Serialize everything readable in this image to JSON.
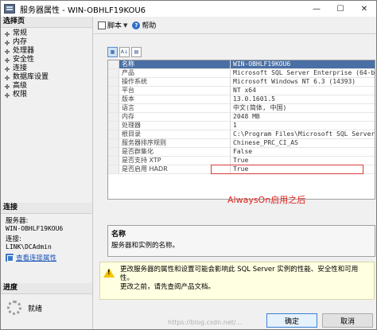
{
  "window": {
    "title": "服务器属性 - WIN-OBHLF19KOU6",
    "minimize_label": "—",
    "maximize_label": "☐",
    "close_label": "✕"
  },
  "sidebar": {
    "select_page_header": "选择页",
    "items": [
      {
        "label": "常规"
      },
      {
        "label": "内存"
      },
      {
        "label": "处理器"
      },
      {
        "label": "安全性"
      },
      {
        "label": "连接"
      },
      {
        "label": "数据库设置"
      },
      {
        "label": "高级"
      },
      {
        "label": "权限"
      }
    ],
    "connection_header": "连接",
    "server_label": "服务器:",
    "server_value": "WIN-OBHLF19KOU6",
    "connection_label": "连接:",
    "connection_value": "LINK\\DCAdmin",
    "view_props_link": "查看连接属性",
    "progress_header": "进度",
    "progress_status": "就绪"
  },
  "toolbar": {
    "script_label": "脚本",
    "help_label": "帮助"
  },
  "grid": {
    "rows": [
      {
        "name": "名称",
        "value": "WIN-OBHLF19KOU6"
      },
      {
        "name": "产品",
        "value": "Microsoft SQL Server Enterprise (64-bit)"
      },
      {
        "name": "操作系统",
        "value": "Microsoft Windows NT 6.3 (14393)"
      },
      {
        "name": "平台",
        "value": "NT x64"
      },
      {
        "name": "版本",
        "value": "13.0.1601.5"
      },
      {
        "name": "语言",
        "value": "中文(简体, 中国)"
      },
      {
        "name": "内存",
        "value": "2048 MB"
      },
      {
        "name": "处理器",
        "value": "1"
      },
      {
        "name": "根目录",
        "value": "C:\\Program Files\\Microsoft SQL Server\\MSS"
      },
      {
        "name": "服务器排序规则",
        "value": "Chinese_PRC_CI_AS"
      },
      {
        "name": "是否群集化",
        "value": "False"
      },
      {
        "name": "是否支持 XTP",
        "value": "True"
      },
      {
        "name": "是否启用 HADR",
        "value": "True"
      }
    ]
  },
  "annotation": {
    "text": "AlwaysOn启用之后",
    "color": "#e0251d"
  },
  "description": {
    "title": "名称",
    "text": "服务器和实例的名称。"
  },
  "warning": {
    "line1": "更改服务器的属性和设置可能会影响此 SQL Server 实例的性能、安全性和可用性。",
    "line2": "更改之前，请先查阅产品文档。"
  },
  "footer": {
    "ok_label": "确定",
    "cancel_label": "取消"
  },
  "watermark": "https://blog.csdn.net/..."
}
